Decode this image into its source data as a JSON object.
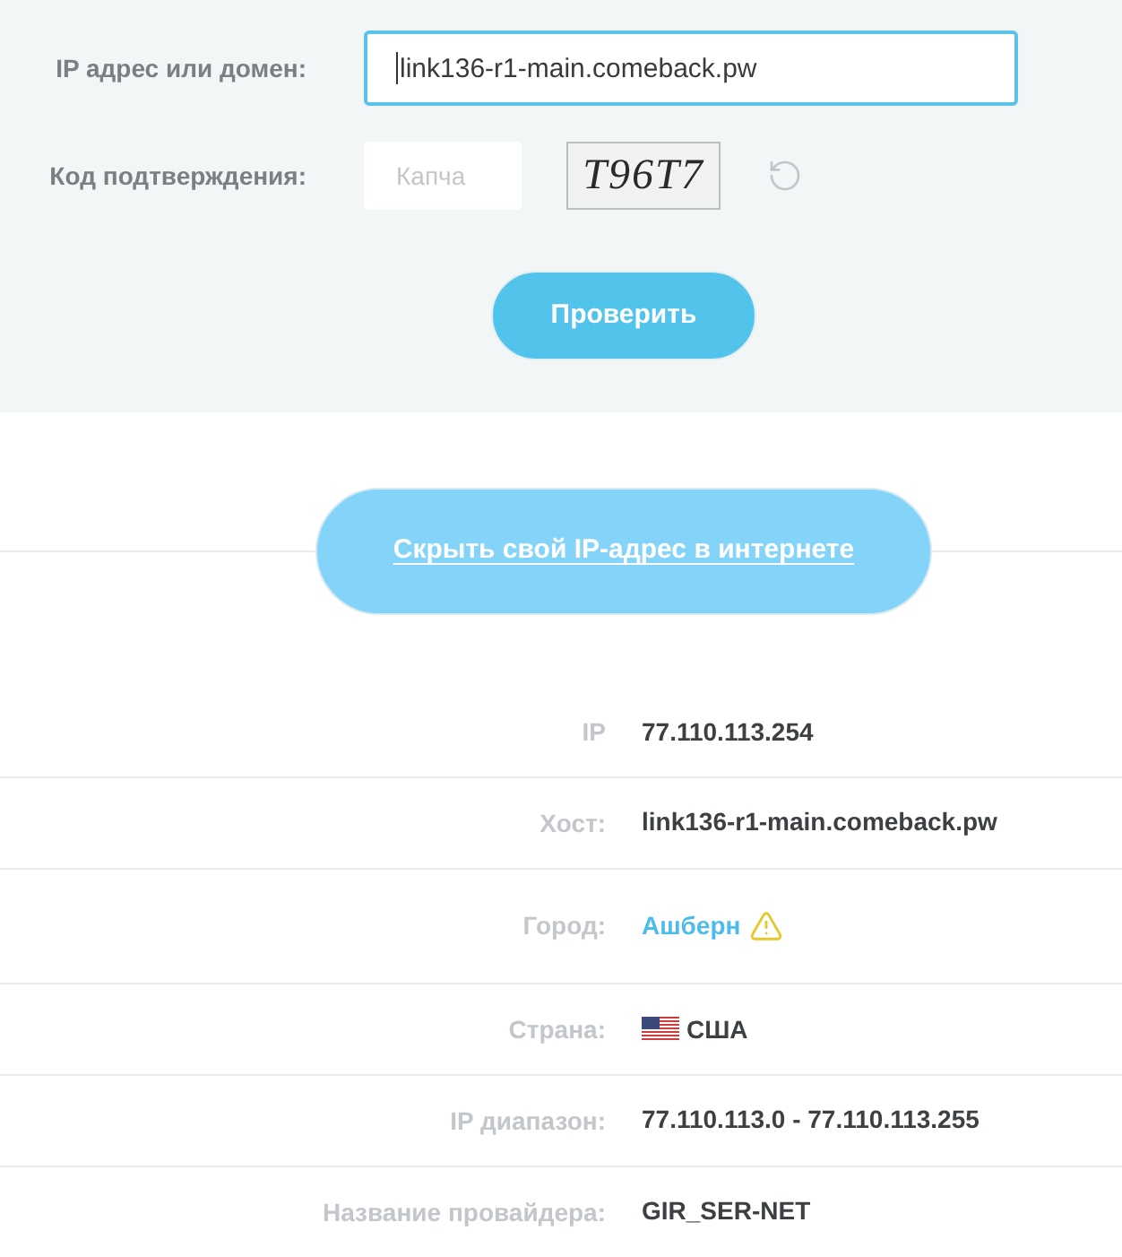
{
  "form": {
    "fields": [
      {
        "kind": "text",
        "label": "IP адрес или домен:",
        "value": "link136-r1-main.comeback.pw",
        "focused": true
      },
      {
        "kind": "captcha",
        "label": "Код подтверждения:",
        "placeholder": "Капча",
        "captcha_text": "T96T7"
      }
    ],
    "submit_button": "Проверить"
  },
  "hide_ip_button": "Скрыть свой IP-адрес в интернете",
  "info_rows": [
    {
      "kind": "plain",
      "label": "IP",
      "value": "77.110.113.254"
    },
    {
      "kind": "plain",
      "label": "Хост:",
      "value": "link136-r1-main.comeback.pw"
    },
    {
      "kind": "warning_link",
      "label": "Город:",
      "value": "Ашберн"
    },
    {
      "kind": "flag",
      "label": "Страна:",
      "value": "США"
    },
    {
      "kind": "plain",
      "label": "IP диапазон:",
      "value": "77.110.113.0 - 77.110.113.255"
    },
    {
      "kind": "plain",
      "label": "Название провайдера:",
      "value": "GIR_SER-NET"
    }
  ]
}
